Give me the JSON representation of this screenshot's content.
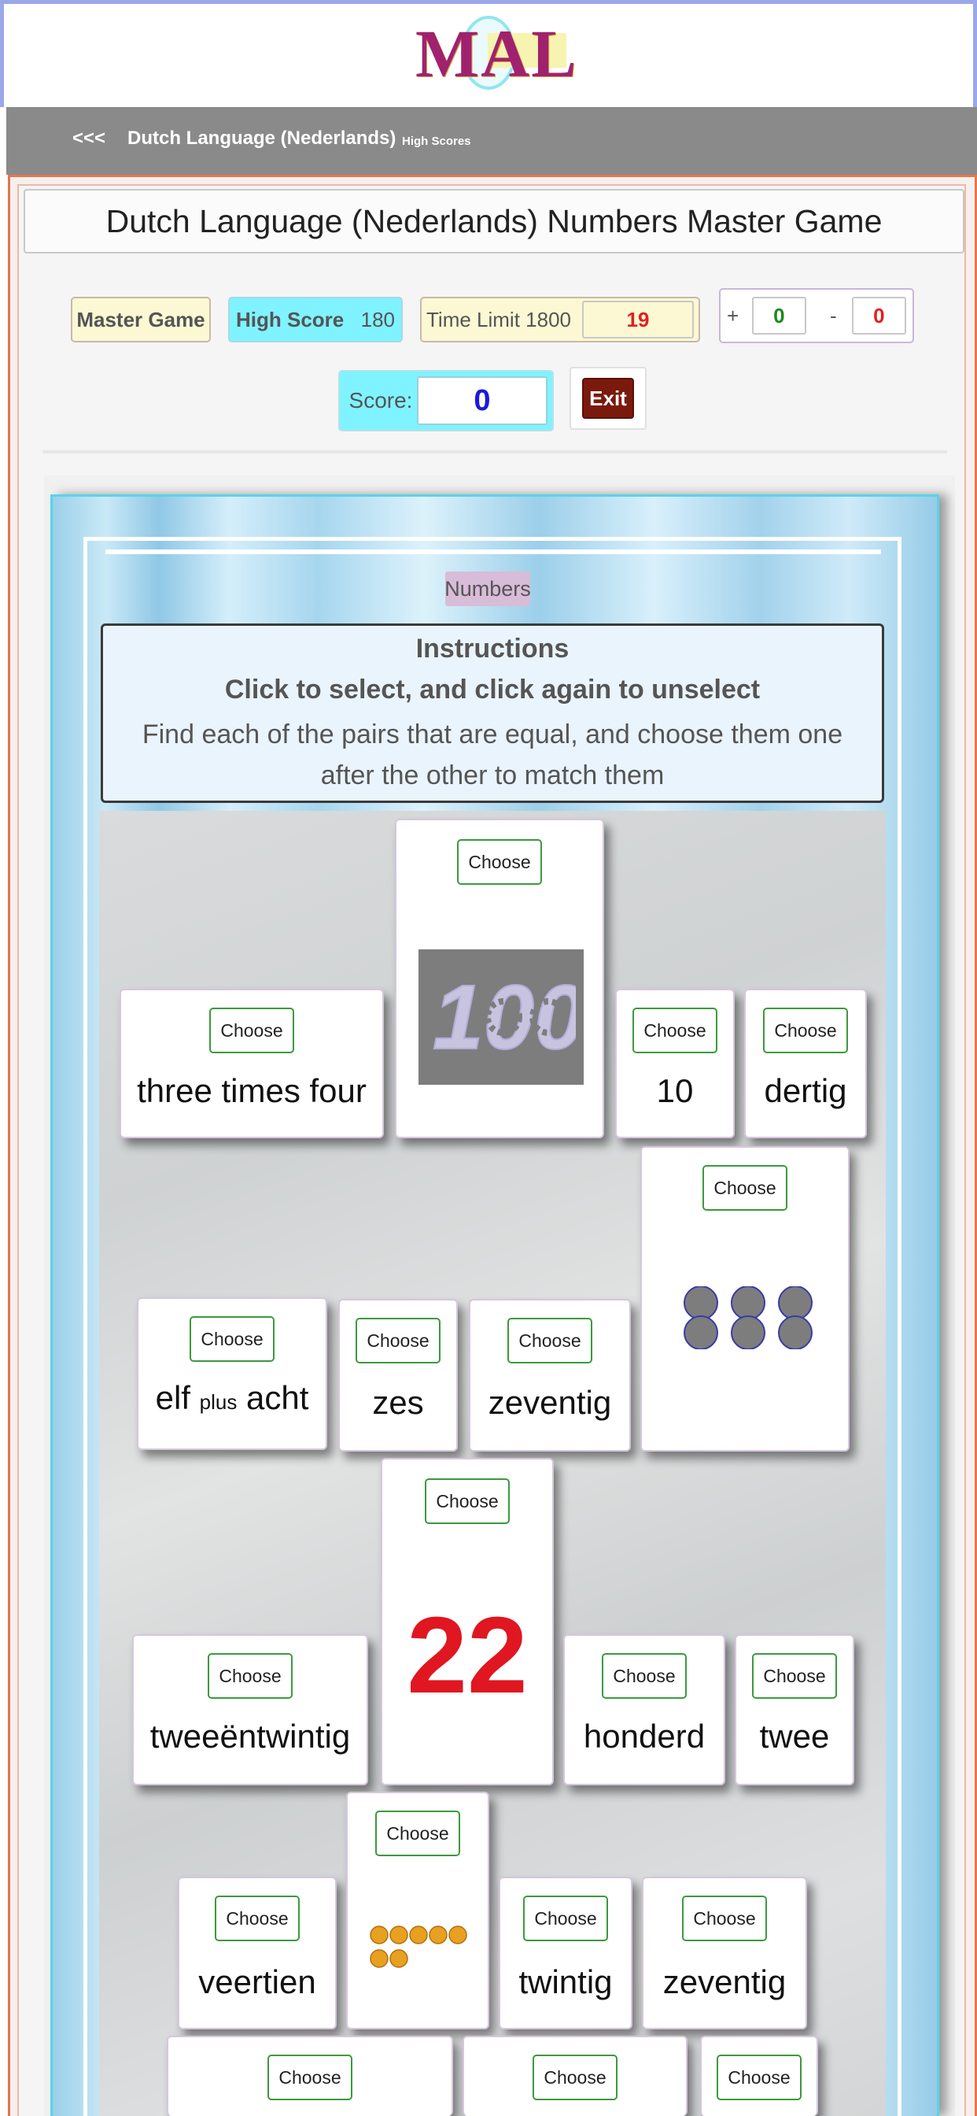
{
  "brand": {
    "logo": "MAL"
  },
  "nav": {
    "back": "<<<",
    "title": "Dutch Language (Nederlands)",
    "high_scores": "High Scores"
  },
  "game": {
    "title": "Dutch Language (Nederlands) Numbers Master Game",
    "mode": "Master Game",
    "high_score_label": "High Score",
    "high_score_value": "180",
    "time_limit_label": "Time Limit 1800",
    "time_remaining": "19",
    "plus_sign": "+",
    "plus_value": "0",
    "minus_sign": "-",
    "minus_value": "0",
    "score_label": "Score:",
    "score_value": "0",
    "exit_label": "Exit"
  },
  "board": {
    "category": "Numbers",
    "instructions_title": "Instructions",
    "instructions_line1": "Click to select, and click again to unselect",
    "instructions_line2": "Find each of the pairs that are equal, and choose them one after the other to match them"
  },
  "choose_label": "Choose",
  "cards": [
    {
      "id": "three-times-four",
      "text": "three times four"
    },
    {
      "id": "image-100",
      "image": "100",
      "icon": "gear-100-icon"
    },
    {
      "id": "10",
      "text": "10"
    },
    {
      "id": "dertig",
      "text": "dertig"
    },
    {
      "id": "elf-plus-acht",
      "text_a": "elf",
      "text_mid": "plus",
      "text_b": "acht"
    },
    {
      "id": "zes",
      "text": "zes"
    },
    {
      "id": "zeventig-1",
      "text": "zeventig"
    },
    {
      "id": "six-dots",
      "image": "6 dots",
      "icon": "six-dots-icon"
    },
    {
      "id": "tweeentwintig",
      "text": "tweeëntwintig"
    },
    {
      "id": "22",
      "text": "22"
    },
    {
      "id": "honderd",
      "text": "honderd"
    },
    {
      "id": "twee",
      "text": "twee"
    },
    {
      "id": "veertien",
      "text": "veertien"
    },
    {
      "id": "seven-dots",
      "image": "7 dots",
      "icon": "seven-dots-icon"
    },
    {
      "id": "twintig",
      "text": "twintig"
    },
    {
      "id": "zeventig-2",
      "text": "zeventig"
    }
  ],
  "colors": {
    "nav_bar": "#8a8a8a",
    "frame_orange": "#e8754a",
    "pill_cyan": "#7ff3ff",
    "pill_cream": "#fdf8d4",
    "score_blue": "#1a1ad8",
    "time_red": "#e02020",
    "plus_green": "#1a8a1a",
    "exit_red": "#7a1a0c",
    "big_number_red": "#e01620",
    "dot_fill": "#7d7d7d",
    "dot_border": "#3a3aa8",
    "orange_dot": "#e8a020"
  }
}
